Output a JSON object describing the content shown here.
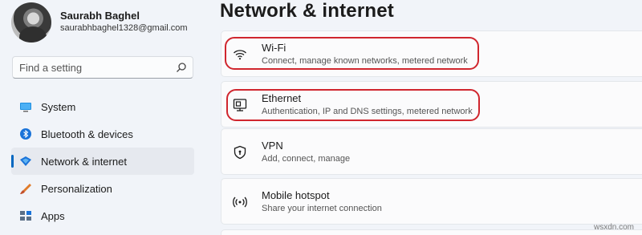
{
  "profile": {
    "name": "Saurabh Baghel",
    "email": "saurabhbaghel1328@gmail.com"
  },
  "search": {
    "placeholder": "Find a setting",
    "icon": "search-icon"
  },
  "sidebar": {
    "items": [
      {
        "label": "System",
        "icon": "monitor-icon",
        "active": false
      },
      {
        "label": "Bluetooth & devices",
        "icon": "bluetooth-icon",
        "active": false
      },
      {
        "label": "Network & internet",
        "icon": "wifi-diamond-icon",
        "active": true
      },
      {
        "label": "Personalization",
        "icon": "brush-icon",
        "active": false
      },
      {
        "label": "Apps",
        "icon": "apps-icon",
        "active": false
      }
    ]
  },
  "main": {
    "title": "Network & internet",
    "cards": [
      {
        "title": "Wi-Fi",
        "subtitle": "Connect, manage known networks, metered network",
        "icon": "wifi-icon",
        "highlighted": true
      },
      {
        "title": "Ethernet",
        "subtitle": "Authentication, IP and DNS settings, metered network",
        "icon": "ethernet-icon",
        "highlighted": true
      },
      {
        "title": "VPN",
        "subtitle": "Add, connect, manage",
        "icon": "shield-icon",
        "highlighted": false
      },
      {
        "title": "Mobile hotspot",
        "subtitle": "Share your internet connection",
        "icon": "hotspot-icon",
        "highlighted": false
      }
    ]
  },
  "watermark": "wsxdn.com",
  "colors": {
    "accent": "#0067c0",
    "highlight_outline": "#d0262e",
    "background": "#f1f4f9",
    "card": "#fbfbfc"
  }
}
